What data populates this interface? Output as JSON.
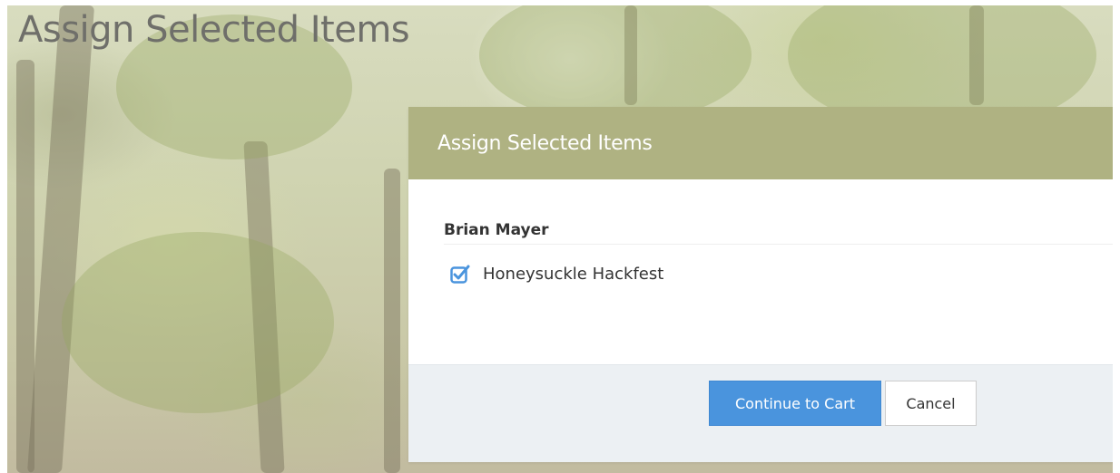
{
  "page": {
    "title": "Assign Selected Items"
  },
  "modal": {
    "title": "Assign Selected Items",
    "person_name": "Brian Mayer",
    "items": [
      {
        "label": "Honeysuckle Hackfest",
        "checked": true,
        "icon": "checkbox-checked-icon"
      }
    ],
    "buttons": {
      "continue_label": "Continue to Cart",
      "cancel_label": "Cancel"
    }
  },
  "colors": {
    "header_bg": "#afb282",
    "primary_button": "#4a94dd",
    "footer_bg": "#ecf0f3",
    "checkbox": "#4a94dd"
  }
}
